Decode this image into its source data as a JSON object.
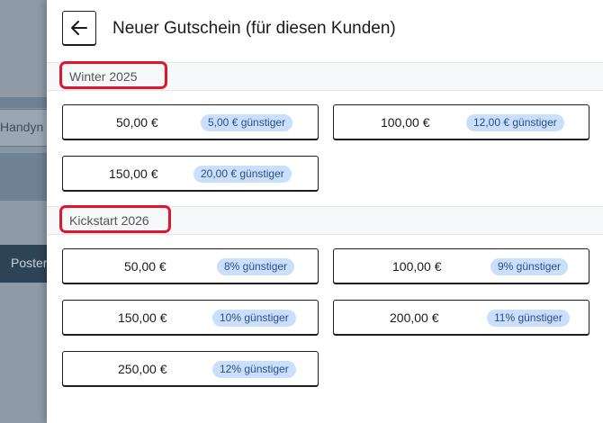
{
  "background": {
    "field_text": "Handyn",
    "button_text": "Poster"
  },
  "header": {
    "back_icon": "arrow-left-icon",
    "title": "Neuer Gutschein (für diesen Kunden)"
  },
  "sections": [
    {
      "label": "Winter 2025",
      "vouchers": [
        {
          "amount": "50,00 €",
          "badge": "5,00 € günstiger"
        },
        {
          "amount": "100,00 €",
          "badge": "12,00 € günstiger"
        },
        {
          "amount": "150,00 €",
          "badge": "20,00 € günstiger"
        }
      ]
    },
    {
      "label": "Kickstart 2026",
      "vouchers": [
        {
          "amount": "50,00 €",
          "badge": "8% günstiger"
        },
        {
          "amount": "100,00 €",
          "badge": "9% günstiger"
        },
        {
          "amount": "150,00 €",
          "badge": "10% günstiger"
        },
        {
          "amount": "200,00 €",
          "badge": "11% günstiger"
        },
        {
          "amount": "250,00 €",
          "badge": "12% günstiger"
        }
      ]
    }
  ],
  "colors": {
    "highlight": "#e0162b",
    "badge_bg": "#c9dffb",
    "badge_text": "#2b4f85"
  }
}
